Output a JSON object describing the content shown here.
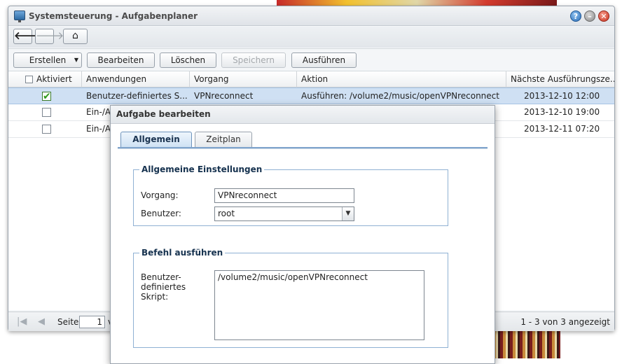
{
  "window": {
    "title": "Systemsteuerung - Aufgabenplaner",
    "controls": {
      "help": "?",
      "minimize": "–",
      "close": "✕"
    }
  },
  "nav": {
    "back": "🡐",
    "forward": "🡒",
    "home": "⌂"
  },
  "toolbar": {
    "create": "Erstellen",
    "edit": "Bearbeiten",
    "delete": "Löschen",
    "save": "Speichern",
    "run": "Ausführen"
  },
  "grid": {
    "columns": [
      "Aktiviert",
      "Anwendungen",
      "Vorgang",
      "Aktion",
      "Nächste Ausführungsze..."
    ],
    "rows": [
      {
        "enabled": true,
        "application": "Benutzer-definiertes S...",
        "task": "VPNreconnect",
        "action": "Ausführen: /volume2/music/openVPNreconnect",
        "next_run": "2013-12-10 12:00"
      },
      {
        "enabled": false,
        "application": "Ein-/A",
        "task": "",
        "action": "",
        "next_run": "2013-12-10 19:00"
      },
      {
        "enabled": false,
        "application": "Ein-/A",
        "task": "",
        "action": "",
        "next_run": "2013-12-11 07:20"
      }
    ]
  },
  "pager": {
    "page_label": "Seite",
    "page_value": "1",
    "of_label": "v",
    "info": "1 - 3 von 3 angezeigt"
  },
  "dialog": {
    "title": "Aufgabe bearbeiten",
    "tabs": [
      "Allgemein",
      "Zeitplan"
    ],
    "general_settings": {
      "legend": "Allgemeine Einstellungen",
      "task_label": "Vorgang:",
      "task_value": "VPNreconnect",
      "user_label": "Benutzer:",
      "user_value": "root"
    },
    "run_command": {
      "legend": "Befehl ausführen",
      "script_label": "Benutzer-\ndefiniertes\nSkript:",
      "script_value": "/volume2/music/openVPNreconnect"
    }
  }
}
